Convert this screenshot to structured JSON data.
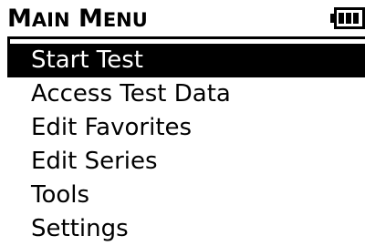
{
  "header": {
    "title_first_big": "M",
    "title_first_rest": "AIN",
    "title_second_big": "M",
    "title_second_rest": "ENU",
    "battery_icon": "battery-icon",
    "battery_level": 0.75
  },
  "menu": {
    "selected_index": 0,
    "items": [
      {
        "label": "Start Test"
      },
      {
        "label": "Access Test Data"
      },
      {
        "label": "Edit Favorites"
      },
      {
        "label": "Edit Series"
      },
      {
        "label": "Tools"
      },
      {
        "label": "Settings"
      }
    ]
  },
  "colors": {
    "background": "#ffffff",
    "foreground": "#000000",
    "highlight": "#000000",
    "highlight_text": "#ffffff"
  }
}
